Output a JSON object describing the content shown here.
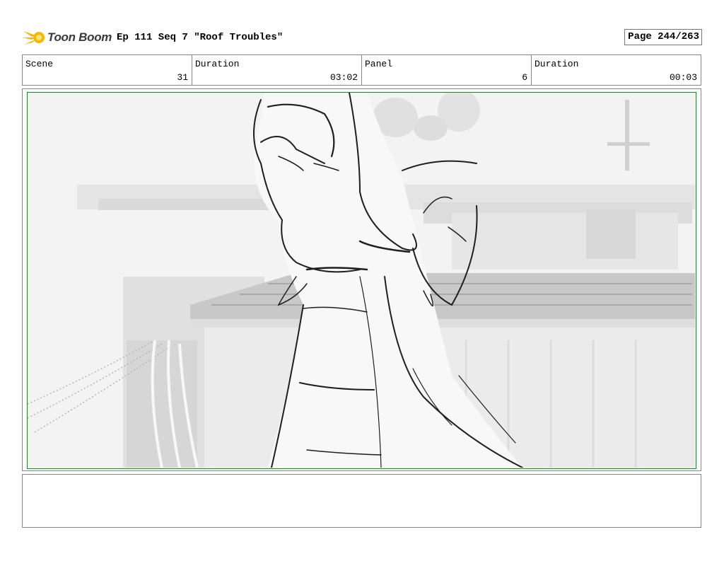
{
  "header": {
    "logo_text": "Toon Boom",
    "title": "Ep 111 Seq 7 \"Roof Troubles\"",
    "page": "Page 244/263"
  },
  "info": {
    "scene_label": "Scene",
    "scene_value": "31",
    "scene_duration_label": "Duration",
    "scene_duration_value": "03:02",
    "panel_label": "Panel",
    "panel_value": "6",
    "panel_duration_label": "Duration",
    "panel_duration_value": "00:03"
  },
  "colors": {
    "panel_border": "#2e7d32",
    "logo_accent": "#f5b800"
  },
  "notes": {
    "text": ""
  }
}
